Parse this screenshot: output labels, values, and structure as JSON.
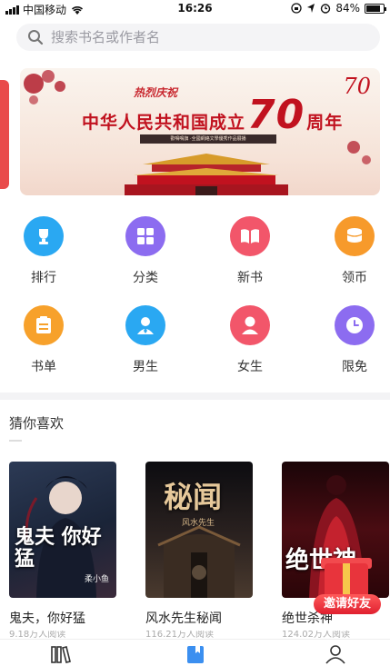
{
  "status_bar": {
    "carrier": "中国移动",
    "time": "16:26",
    "battery": "84%",
    "battery_level": 0.84
  },
  "search": {
    "placeholder": "搜索书名或作者名"
  },
  "banner": {
    "tag": "热烈庆祝",
    "title_prefix": "中华人民共和国成立",
    "title_number": "70",
    "title_suffix": "周年",
    "subtitle": "歡鳴鳴旗 ·全國網絡文學優秀作品展播",
    "logo": "70"
  },
  "categories": [
    {
      "label": "排行",
      "icon": "trophy-icon",
      "color": "#2aa8f2"
    },
    {
      "label": "分类",
      "icon": "grid-icon",
      "color": "#8c6cf0"
    },
    {
      "label": "新书",
      "icon": "open-book-icon",
      "color": "#f2566a"
    },
    {
      "label": "领币",
      "icon": "coins-icon",
      "color": "#f79a2b"
    },
    {
      "label": "书单",
      "icon": "list-icon",
      "color": "#f7a12b"
    },
    {
      "label": "男生",
      "icon": "male-user-icon",
      "color": "#2aa8f2"
    },
    {
      "label": "女生",
      "icon": "female-user-icon",
      "color": "#f2566a"
    },
    {
      "label": "限免",
      "icon": "clock-icon",
      "color": "#8c6cf0"
    }
  ],
  "recommend": {
    "title": "猜你喜欢",
    "books": [
      {
        "title": "鬼夫，你好猛",
        "stat": "9.18万人阅读",
        "cover_title": "鬼夫 你好猛",
        "cover_author": "柔小鱼"
      },
      {
        "title": "风水先生秘闻",
        "stat": "116.21万人阅读",
        "cover_title": "秘闻",
        "cover_author": "风水先生"
      },
      {
        "title": "绝世杀神",
        "stat": "124.02万人阅读",
        "cover_title": "绝世神",
        "cover_author": ""
      }
    ]
  },
  "invite": {
    "label": "邀请好友"
  },
  "tabbar": {
    "items": [
      "bookshelf-icon",
      "bookstore-icon",
      "profile-icon"
    ]
  }
}
